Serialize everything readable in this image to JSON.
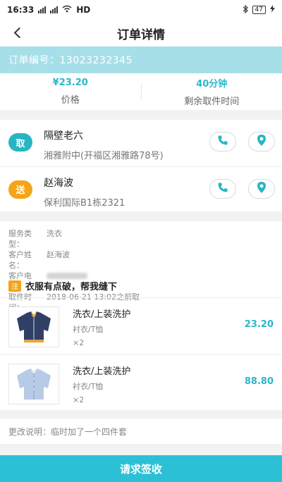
{
  "status_bar": {
    "time": "16:33",
    "network": "HD",
    "battery": "47"
  },
  "nav": {
    "title": "订单详情"
  },
  "order": {
    "number_text": "订单编号：13023232345"
  },
  "stats": {
    "price_value": "¥23.20",
    "price_label": "价格",
    "time_value": "40分钟",
    "time_label": "剩余取件时间"
  },
  "pickup": {
    "badge": "取",
    "name": "隔壁老六",
    "address": "湘雅附中(开福区湘雅路78号)"
  },
  "delivery": {
    "badge": "送",
    "name": "赵海波",
    "address": "保利国际B1栋2321"
  },
  "info": {
    "service_label": "服务类型：",
    "service_value": "洗衣",
    "customer_label": "客户姓名：",
    "customer_value": "赵海波",
    "phone_label": "客户电话：",
    "pickup_time_label": "取件时间：",
    "pickup_time_value": "2018-06-21 13:02之前取"
  },
  "note": {
    "tag": "注",
    "text": "衣服有点破，帮我缝下"
  },
  "items": [
    {
      "name": "洗衣/上装洗护",
      "sub": "衬衣/T恤",
      "qty": "×2",
      "price": "23.20",
      "icon": "dark-jacket-icon"
    },
    {
      "name": "洗衣/上装洗护",
      "sub": "衬衣/T恤",
      "qty": "×2",
      "price": "88.80",
      "icon": "light-shirt-icon"
    }
  ],
  "change_note": "更改说明：临时加了一个四件套",
  "submit_label": "请求签收",
  "colors": {
    "accent": "#2bc0d6",
    "header_band": "#a6dfe8",
    "send_badge": "#f4a416"
  }
}
